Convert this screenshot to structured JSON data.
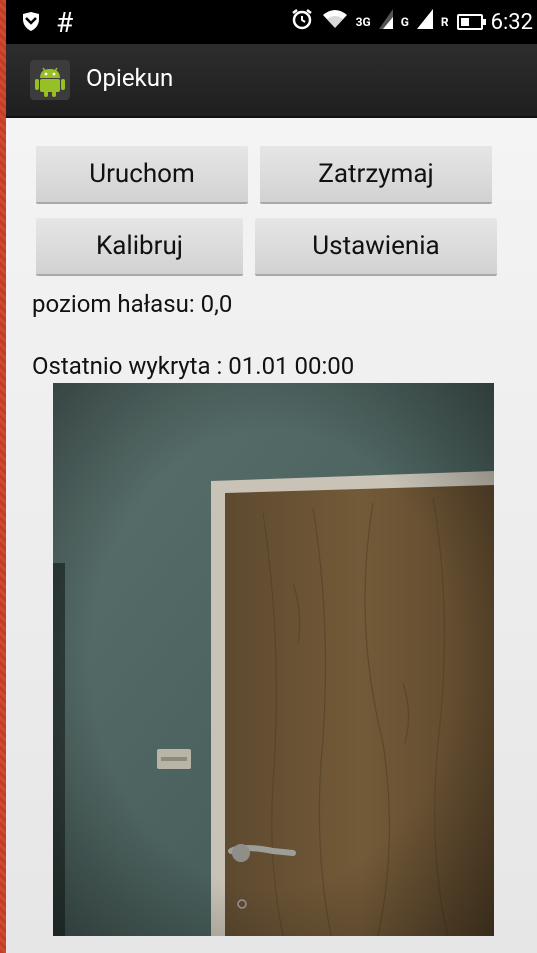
{
  "status_bar": {
    "left_icons": [
      "shield-icon",
      "hash-icon"
    ],
    "hash_symbol": "#",
    "network_3g": "3G",
    "network_g": "G",
    "roaming": "R",
    "time": "6:32"
  },
  "action_bar": {
    "app_icon": "android-icon",
    "title": "Opiekun"
  },
  "buttons": {
    "start": "Uruchom",
    "stop": "Zatrzymaj",
    "calibrate": "Kalibruj",
    "settings": "Ustawienia"
  },
  "noise_level": "poziom hałasu: 0,0",
  "last_detected": "Ostatnio wykryta : 01.01 00:00",
  "colors": {
    "frame": "#c8402a",
    "status_bar": "#000000",
    "action_bar": "#262626",
    "content_bg": "#f0f0f0",
    "button_bg": "#dcdcdc"
  }
}
